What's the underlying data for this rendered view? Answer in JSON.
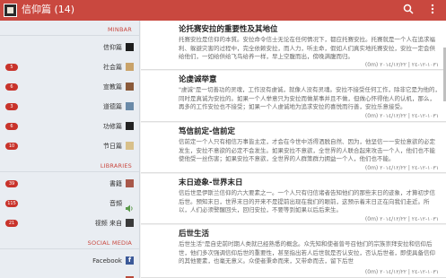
{
  "appbar": {
    "title": "信仰篇 (14)",
    "search_icon": "search-icon",
    "menu_icon": "more-vert-icon"
  },
  "sidebar": {
    "sections": [
      {
        "header": "MINBAR",
        "items": [
          {
            "badge": "",
            "label": "信仰篇",
            "icon": "book-thumb"
          },
          {
            "badge": "5",
            "label": "社会篇",
            "icon": "book-thumb"
          },
          {
            "badge": "6",
            "label": "宣教篇",
            "icon": "book-thumb"
          },
          {
            "badge": "3",
            "label": "道德篇",
            "icon": "book-thumb"
          },
          {
            "badge": "6",
            "label": "功修篇",
            "icon": "book-thumb"
          },
          {
            "badge": "10",
            "label": "节日篇",
            "icon": "book-thumb"
          }
        ]
      },
      {
        "header": "LIBRARIES",
        "items": [
          {
            "badge": "39",
            "label": "書籍",
            "icon": "book-thumb"
          },
          {
            "badge": "115",
            "label": "音頻",
            "icon": "speaker-icon"
          },
          {
            "badge": "21",
            "label": "视频 来自",
            "icon": "video-thumb"
          }
        ]
      },
      {
        "header": "SOCIAL MEDIA",
        "items": [
          {
            "badge": "",
            "label": "Facebook",
            "icon": "facebook-icon"
          },
          {
            "badge": "",
            "label": "",
            "icon": "book-thumb"
          }
        ]
      }
    ]
  },
  "articles": [
    {
      "title": "论托赛安拉的重要性及其地位",
      "body": "托赛安拉是信仰的本質。安拉命令信士无论在任何情况下，都应托赛安拉。托赛就是一个人在追求福利、躲避灾害的过程中，完全依赖安拉，而人力，听主命，假如人们真实地托赛安拉，安拉一定会供给他们，一如给供给飞鸟给养一样，早上空腹而出，傍晚满腹而归。",
      "count": "(0m)",
      "meta": "١٠٣١-١٢-٢٤ | ٢٠١٤/١٢/٢٢"
    },
    {
      "title": "论虔诚举意",
      "body": "\"虔诚\"是一切善功的灵魂，工作没有虔诚，就像人没有灵魂。安拉不接受任何工作，除非它是为他的，同时是真诚为安拉的。如果一个人举意只为安拉而做某事并且不做，但做心怀得他人的认机，那么，再多的工作安拉也不接受；如果一个人虔诚地为追求安拉的喜悦而行善，安拉乐意接受。",
      "count": "(0m)",
      "meta": "١٠٣١-١٢-٢٤ | ٢٠١٤/١٢/٢٢"
    },
    {
      "title": "笃信前定-信前定",
      "body": "信前定一个人只有相信万事皆主定，才会在今世中活得洒脱自然、因为，他坚信一一安拉意欲的必定发生，安拉不意欲的必定不会发生。如果安拉不意欲，全世界的人联合起来攻击一个人，他们也不能使他受一丝伤害；如果安拉不意欲，全世界的人群策群力拥益一个人，他们也不能。",
      "count": "(0m)",
      "meta": "١٠٣١-١٢-٢٤ | ٢٠١٤/١٢/٢٢"
    },
    {
      "title": "末日迹象-世界末日",
      "body": "信后世是伊斯兰信仰的六大要素之一。一个人只有归信诸者告知他们的那些末日的迹象，才算初步信后世。预知末日，世界末日的开来不是提前出现在我们的眼前，这预示着末日正在向我们走近。所以，人们必须警醒回头，回归安拉，不要等到如果以后后来生。",
      "count": "(0m)",
      "meta": "١٠٣١-١٢-٢٤ | ٢٠١٤/١٢/٢٢"
    },
    {
      "title": "后世生活",
      "body": "后世生活\"是自史前时期人类就已经熟悉的概念。众先知和使者曾号召他们的宗族崇拜安拉和信仰后世，他们多次强调信仰后世的重要性，甚至指出若人后世就是否认安拉，否认后世者，即使具备信仰的其他要素，也毫无意义。众使者秉命而来，又带命而去，留下后世",
      "count": "(0m)",
      "meta": "١٠٣١-١٢-٢٤ | ٢٠١٤/١٢/٢٢"
    }
  ]
}
